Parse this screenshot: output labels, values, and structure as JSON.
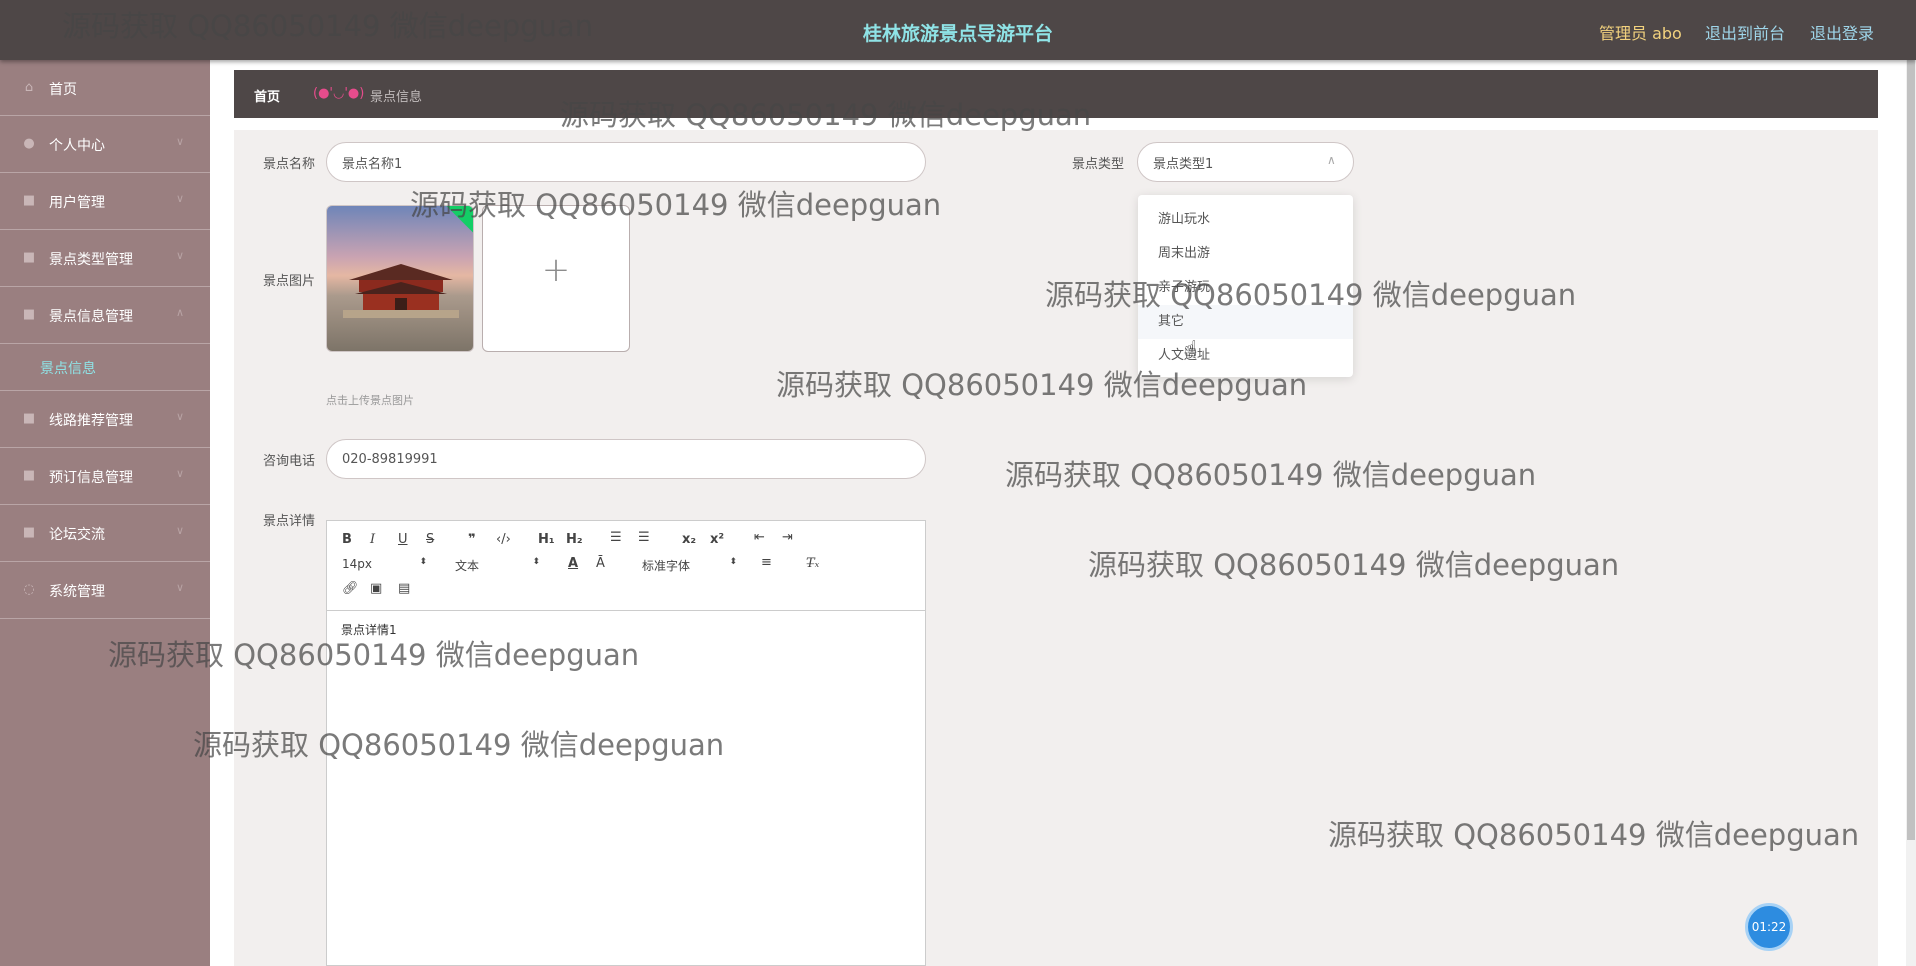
{
  "header": {
    "title": "桂林旅游景点导游平台",
    "user": "管理员 abo",
    "front_link": "退出到前台",
    "logout_link": "退出登录"
  },
  "sidebar": {
    "items": [
      {
        "label": "首页",
        "icon": "home-icon"
      },
      {
        "label": "个人中心",
        "icon": "user-icon"
      },
      {
        "label": "用户管理",
        "icon": "users-icon"
      },
      {
        "label": "景点类型管理",
        "icon": "list-icon"
      },
      {
        "label": "景点信息管理",
        "icon": "list-icon"
      },
      {
        "label": "线路推荐管理",
        "icon": "route-icon"
      },
      {
        "label": "预订信息管理",
        "icon": "calendar-icon"
      },
      {
        "label": "论坛交流",
        "icon": "chat-icon"
      },
      {
        "label": "系统管理",
        "icon": "settings-icon"
      }
    ],
    "active_sub": "景点信息"
  },
  "breadcrumb": {
    "home": "首页",
    "separator": "(●'◡'●)",
    "current": "景点信息"
  },
  "form": {
    "name_label": "景点名称",
    "name_value": "景点名称1",
    "type_label": "景点类型",
    "type_value": "景点类型1",
    "image_label": "景点图片",
    "upload_tip": "点击上传景点图片",
    "phone_label": "咨询电话",
    "phone_value": "020-89819991",
    "detail_label": "景点详情",
    "detail_content": "景点详情1"
  },
  "dropdown": {
    "options": [
      "游山玩水",
      "周末出游",
      "亲子游玩",
      "其它",
      "人文遗址"
    ],
    "hovered": "其它"
  },
  "editor_toolbar": {
    "font_size": "14px",
    "header_type": "文本",
    "font_family": "标准字体"
  },
  "watermark": "源码获取 QQ86050149 微信deepguan",
  "timer": "01:22",
  "colors": {
    "topbar": "#4e4747",
    "title": "#8fe3e6",
    "user": "#f2d27e",
    "sidebar": "#9a7f80",
    "active_sub": "#8fe3e6",
    "breadcrumb_sep": "#e64c8c",
    "timer": "#2d8ce0"
  }
}
